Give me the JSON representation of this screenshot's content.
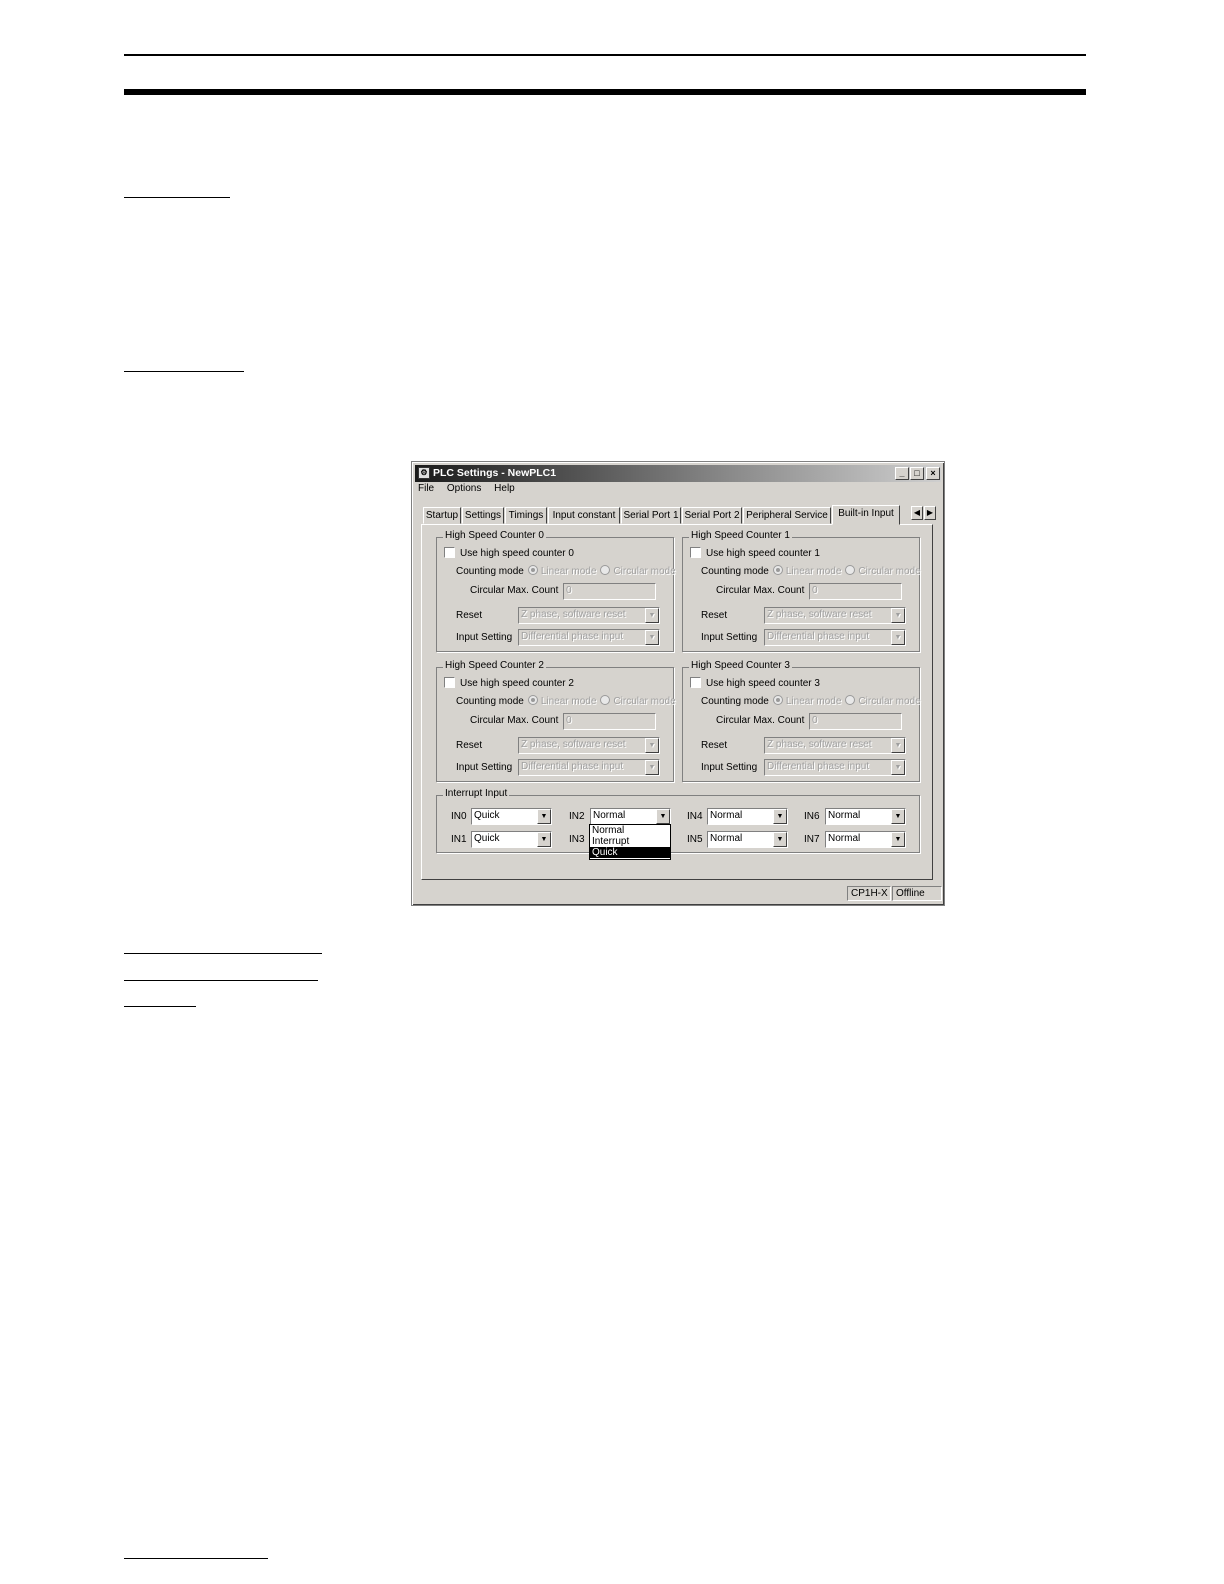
{
  "window": {
    "title": "PLC Settings - NewPLC1",
    "minimize": "_",
    "maximize": "□",
    "close": "×"
  },
  "menu": [
    "File",
    "Options",
    "Help"
  ],
  "tabs": [
    "Startup",
    "Settings",
    "Timings",
    "Input constant",
    "Serial Port 1",
    "Serial Port 2",
    "Peripheral Service",
    "Built-in Input"
  ],
  "active_tab": "Built-in Input",
  "counters": [
    {
      "title": "High Speed Counter 0",
      "use_label": "Use high speed counter 0",
      "counting_mode_label": "Counting mode",
      "linear": "Linear mode",
      "circular": "Circular mode",
      "max_count_label": "Circular Max. Count",
      "max_count_value": "0",
      "reset_label": "Reset",
      "reset_value": "Z phase, software reset",
      "input_label": "Input Setting",
      "input_value": "Differential phase input"
    },
    {
      "title": "High Speed Counter 1",
      "use_label": "Use high speed counter 1",
      "counting_mode_label": "Counting mode",
      "linear": "Linear mode",
      "circular": "Circular mode",
      "max_count_label": "Circular Max. Count",
      "max_count_value": "0",
      "reset_label": "Reset",
      "reset_value": "Z phase, software reset",
      "input_label": "Input Setting",
      "input_value": "Differential phase input"
    },
    {
      "title": "High Speed Counter 2",
      "use_label": "Use high speed counter 2",
      "counting_mode_label": "Counting mode",
      "linear": "Linear mode",
      "circular": "Circular mode",
      "max_count_label": "Circular Max. Count",
      "max_count_value": "0",
      "reset_label": "Reset",
      "reset_value": "Z phase, software reset",
      "input_label": "Input Setting",
      "input_value": "Differential phase input"
    },
    {
      "title": "High Speed Counter 3",
      "use_label": "Use high speed counter 3",
      "counting_mode_label": "Counting mode",
      "linear": "Linear mode",
      "circular": "Circular mode",
      "max_count_label": "Circular Max. Count",
      "max_count_value": "0",
      "reset_label": "Reset",
      "reset_value": "Z phase, software reset",
      "input_label": "Input Setting",
      "input_value": "Differential phase input"
    }
  ],
  "interrupt": {
    "title": "Interrupt Input",
    "inputs": [
      {
        "label": "IN0",
        "value": "Quick"
      },
      {
        "label": "IN1",
        "value": "Quick"
      },
      {
        "label": "IN2",
        "value": "Normal"
      },
      {
        "label": "IN3",
        "value": ""
      },
      {
        "label": "IN4",
        "value": "Normal"
      },
      {
        "label": "IN5",
        "value": "Normal"
      },
      {
        "label": "IN6",
        "value": "Normal"
      },
      {
        "label": "IN7",
        "value": "Normal"
      }
    ],
    "dropdown_options": [
      "Normal",
      "Interrupt",
      "Quick"
    ],
    "dropdown_highlighted": "Quick"
  },
  "status": {
    "model": "CP1H-X",
    "mode": "Offline"
  },
  "icons": {
    "combo_arrow": "▼",
    "scroll_left": "◀",
    "scroll_right": "▶"
  }
}
